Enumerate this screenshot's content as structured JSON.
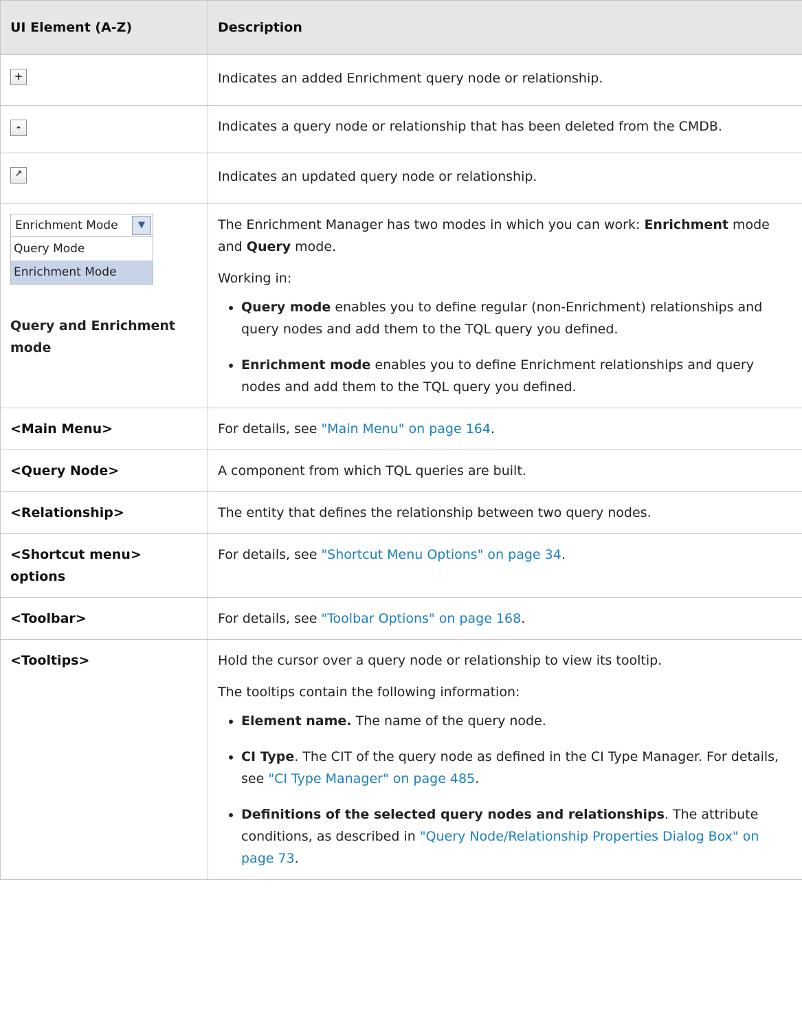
{
  "table": {
    "header": {
      "col1": "UI Element (A-Z)",
      "col2": "Description"
    },
    "icon_rows": [
      {
        "icon": "plus-icon",
        "glyph": "+",
        "desc": "Indicates an added Enrichment query node or relationship."
      },
      {
        "icon": "minus-icon",
        "glyph": "-",
        "desc": "Indicates a query node or relationship that has been deleted from the CMDB."
      },
      {
        "icon": "updated-arrow-icon",
        "glyph": "↗",
        "desc": "Indicates an updated query node or relationship."
      }
    ],
    "mode_row": {
      "combo_value": "Enrichment Mode",
      "options": [
        "Query Mode",
        "Enrichment Mode"
      ],
      "label": "Query and Enrichment mode",
      "intro_pre": "The Enrichment Manager has two modes in which you can work: ",
      "intro_b1": "Enrichment",
      "intro_mid": " mode and ",
      "intro_b2": "Query",
      "intro_post": " mode.",
      "working": "Working in:",
      "bullets": [
        {
          "bold": "Query mode",
          "text": " enables you to define regular (non-Enrichment) relationships and query nodes and add them to the TQL query you defined."
        },
        {
          "bold": "Enrichment mode",
          "text": " enables you to define Enrichment relationships and query nodes and add them to the TQL query you defined."
        }
      ]
    },
    "rows": [
      {
        "element": "<Main Menu>",
        "pre": "For details, see ",
        "link": "\"Main Menu\" on page 164",
        "post": "."
      },
      {
        "element": "<Query Node>",
        "text": "A component from which TQL queries are built."
      },
      {
        "element": "<Relationship>",
        "text": "The entity that defines the relationship between two query nodes."
      },
      {
        "element": "<Shortcut menu> options",
        "pre": "For details, see ",
        "link": "\"Shortcut Menu Options\" on page 34",
        "post": "."
      },
      {
        "element": "<Toolbar>",
        "pre": "For details, see ",
        "link": "\"Toolbar Options\" on page 168",
        "post": "."
      }
    ],
    "tooltips_row": {
      "element": "<Tooltips>",
      "p1": "Hold the cursor over a query node or relationship to view its tooltip.",
      "p2": "The tooltips contain the following information:",
      "b1_bold": "Element name.",
      "b1_text": " The name of the query node.",
      "b2_bold": "CI Type",
      "b2_text": ". The CIT of the query node as defined in the CI Type Manager. For details, see ",
      "b2_link": "\"CI Type Manager\" on page 485",
      "b2_post": ".",
      "b3_bold": "Definitions of the selected query nodes and relationships",
      "b3_text": ". The attribute conditions, as described in ",
      "b3_link": "\"Query Node/Relationship Properties Dialog Box\" on page 73",
      "b3_post": "."
    }
  }
}
